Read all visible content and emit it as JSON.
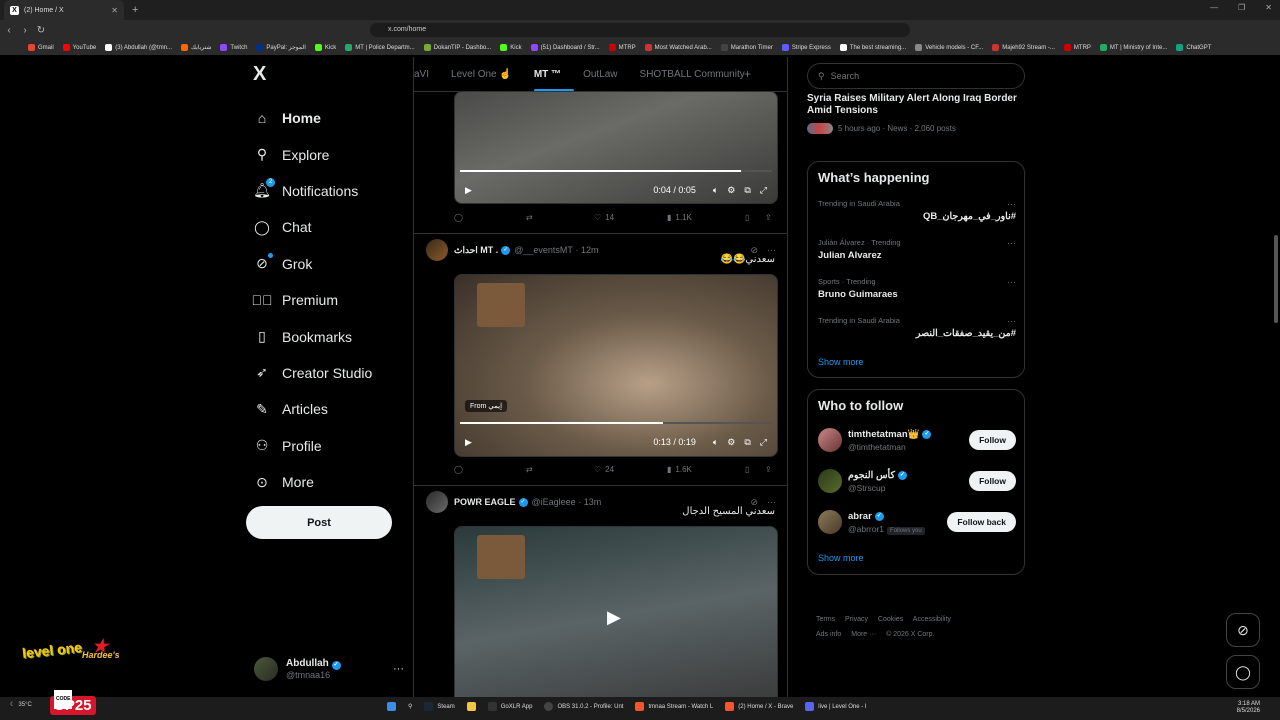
{
  "browser": {
    "tab_title": "(2) Home / X",
    "url": "x.com/home",
    "bookmarks": [
      "Gmail",
      "YouTube",
      "(3) Abdullah (@tmn...",
      "شتريايك",
      "Twitch",
      "PayPal: الموجز",
      "Kick",
      "MT | Police Departm...",
      "DokanTIP - Dashbo...",
      "Kick",
      "(51) Dashboard / Str...",
      "MTRP",
      "Most Watched Arab...",
      "Marathon Timer",
      "Stripe Express",
      "The best streaming...",
      "Vehicle models - CF...",
      "Majeh92 Stream -...",
      "MTRP",
      "MT | Ministry of Inte...",
      "ChatGPT"
    ]
  },
  "sidebar": {
    "logo": "X",
    "items": [
      {
        "label": "Home",
        "icon": "home-icon"
      },
      {
        "label": "Explore",
        "icon": "search-icon"
      },
      {
        "label": "Notifications",
        "icon": "bell-icon",
        "badge": "2"
      },
      {
        "label": "Chat",
        "icon": "chat-icon"
      },
      {
        "label": "Grok",
        "icon": "grok-icon"
      },
      {
        "label": "Premium",
        "icon": "premium-icon"
      },
      {
        "label": "Bookmarks",
        "icon": "bookmark-icon"
      },
      {
        "label": "Creator Studio",
        "icon": "rocket-icon"
      },
      {
        "label": "Articles",
        "icon": "article-icon"
      },
      {
        "label": "Profile",
        "icon": "person-icon"
      },
      {
        "label": "More",
        "icon": "more-circle-icon"
      }
    ],
    "post_label": "Post",
    "account": {
      "name": "Abdullah",
      "handle": "@tmnaa16"
    }
  },
  "feed": {
    "tabs": [
      "aVI",
      "Level One ☝",
      "MT ™",
      "OutLaw",
      "SHOTBALL Community"
    ],
    "posts": [
      {
        "time": "0:04 / 0:05",
        "progress": 0.9,
        "replies": "",
        "reposts": "",
        "likes": "14",
        "views": "1.1K"
      },
      {
        "name": "احداث MT .",
        "handle": "@__eventsMT",
        "age": "12m",
        "text": "سعدني😂😂",
        "from_label": "From",
        "from_name": "إيمي",
        "time": "0:13 / 0:19",
        "progress": 0.65,
        "likes": "24",
        "views": "1.6K"
      },
      {
        "name": "POWR EAGLE",
        "handle": "@iEagleee",
        "age": "13m",
        "text": "سعدني المسيح الدجال"
      }
    ]
  },
  "right": {
    "search_placeholder": "Search",
    "news": {
      "headline": "Syria Raises Military Alert Along Iraq Border Amid Tensions",
      "meta": "5 hours ago · News · 2,060 posts"
    },
    "happening_title": "What’s happening",
    "trends": [
      {
        "context": "Trending in Saudi Arabia",
        "name": "#ناور_في_مهرجان_QB"
      },
      {
        "context": "Julián Álvarez · Trending",
        "name": "Julian Alvarez"
      },
      {
        "context": "Sports · Trending",
        "name": "Bruno Guimaraes"
      },
      {
        "context": "Trending in Saudi Arabia",
        "name": "#من_يقيد_صفقات_النصر"
      }
    ],
    "show_more": "Show more",
    "follow_title": "Who to follow",
    "follow": [
      {
        "name": "timthetatman👑",
        "handle": "@timthetatman",
        "button": "Follow"
      },
      {
        "name": "كأس النجوم",
        "handle": "@Strscup",
        "button": "Follow"
      },
      {
        "name": "abrar",
        "handle": "@abrror1",
        "follows_you": "Follows you",
        "button": "Follow back"
      }
    ],
    "footer": [
      "Terms",
      "Privacy",
      "Cookies",
      "Accessibility",
      "Ads info",
      "More ···",
      "© 2026 X Corp."
    ]
  },
  "overlay": {
    "level_one": "level one",
    "hardees": "Hardee's",
    "promo_code": "CODE",
    "promo": "UP25"
  },
  "taskbar": {
    "weather": "35°C",
    "items": [
      "Steam",
      "GoXLR App",
      "OBS 31.0.2 - Profile: Unt",
      "tmnaa Stream - Watch L",
      "(2) Home / X - Brave",
      "live | Level One - I"
    ],
    "time": "3:18 AM",
    "date": "8/5/2026",
    "lang": "ع"
  },
  "colors": {
    "accent": "#1d9bf0",
    "background": "#000000",
    "border": "#2f3336",
    "muted": "#71767b"
  }
}
